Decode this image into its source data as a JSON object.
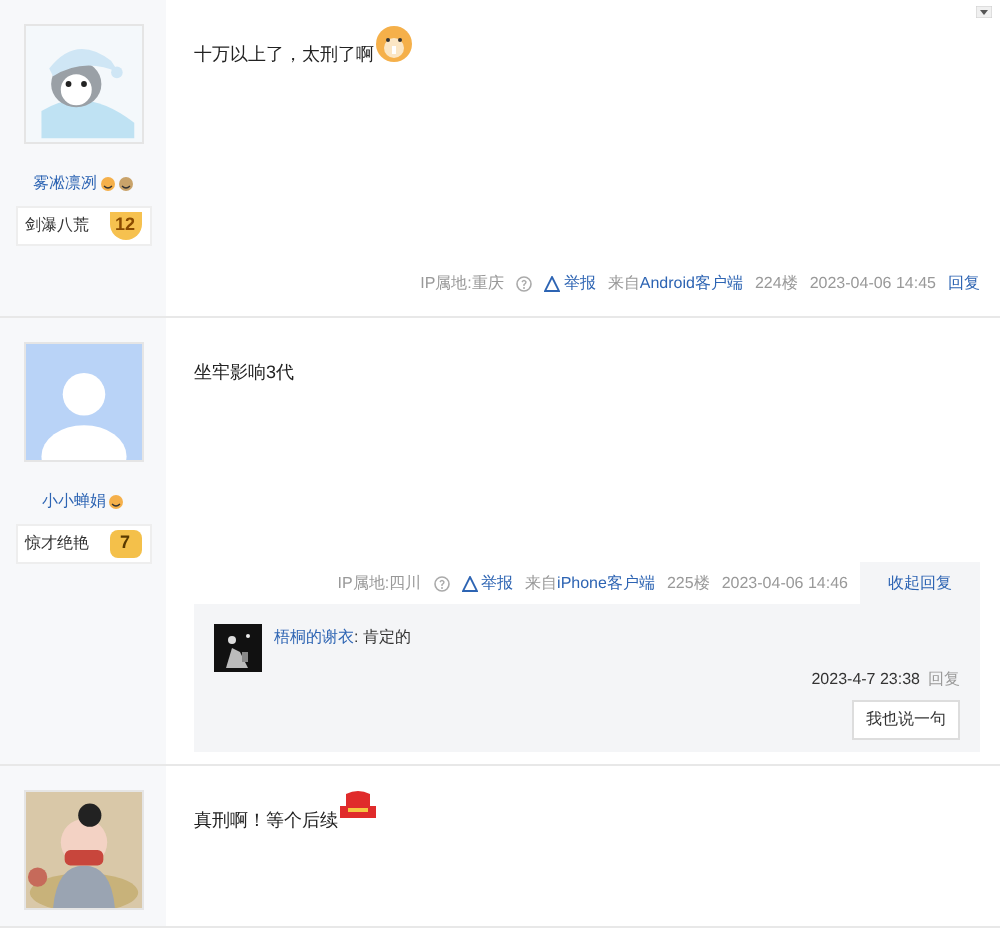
{
  "posts": [
    {
      "user": {
        "name": "雾凇凛冽",
        "badge": "剑瀑八荒",
        "level": "12"
      },
      "content": "十万以上了，太刑了啊",
      "footer": {
        "ip": "IP属地:重庆",
        "report": "举报",
        "source_prefix": "来自",
        "source": "Android客户端",
        "floor": "224楼",
        "time": "2023-04-06 14:45",
        "reply": "回复",
        "expanded": false
      }
    },
    {
      "user": {
        "name": "小小蝉娟",
        "badge": "惊才绝艳",
        "level": "7"
      },
      "content": "坐牢影响3代",
      "footer": {
        "ip": "IP属地:四川",
        "report": "举报",
        "source_prefix": "来自",
        "source": "iPhone客户端",
        "floor": "225楼",
        "time": "2023-04-06 14:46",
        "reply": "收起回复",
        "expanded": true
      },
      "replies": [
        {
          "author": "梧桐的谢衣",
          "separator": ":",
          "text": "肯定的",
          "time": "2023-4-7 23:38",
          "reply": "回复"
        }
      ],
      "reply_button": "我也说一句"
    },
    {
      "content": "真刑啊！等个后续"
    }
  ]
}
